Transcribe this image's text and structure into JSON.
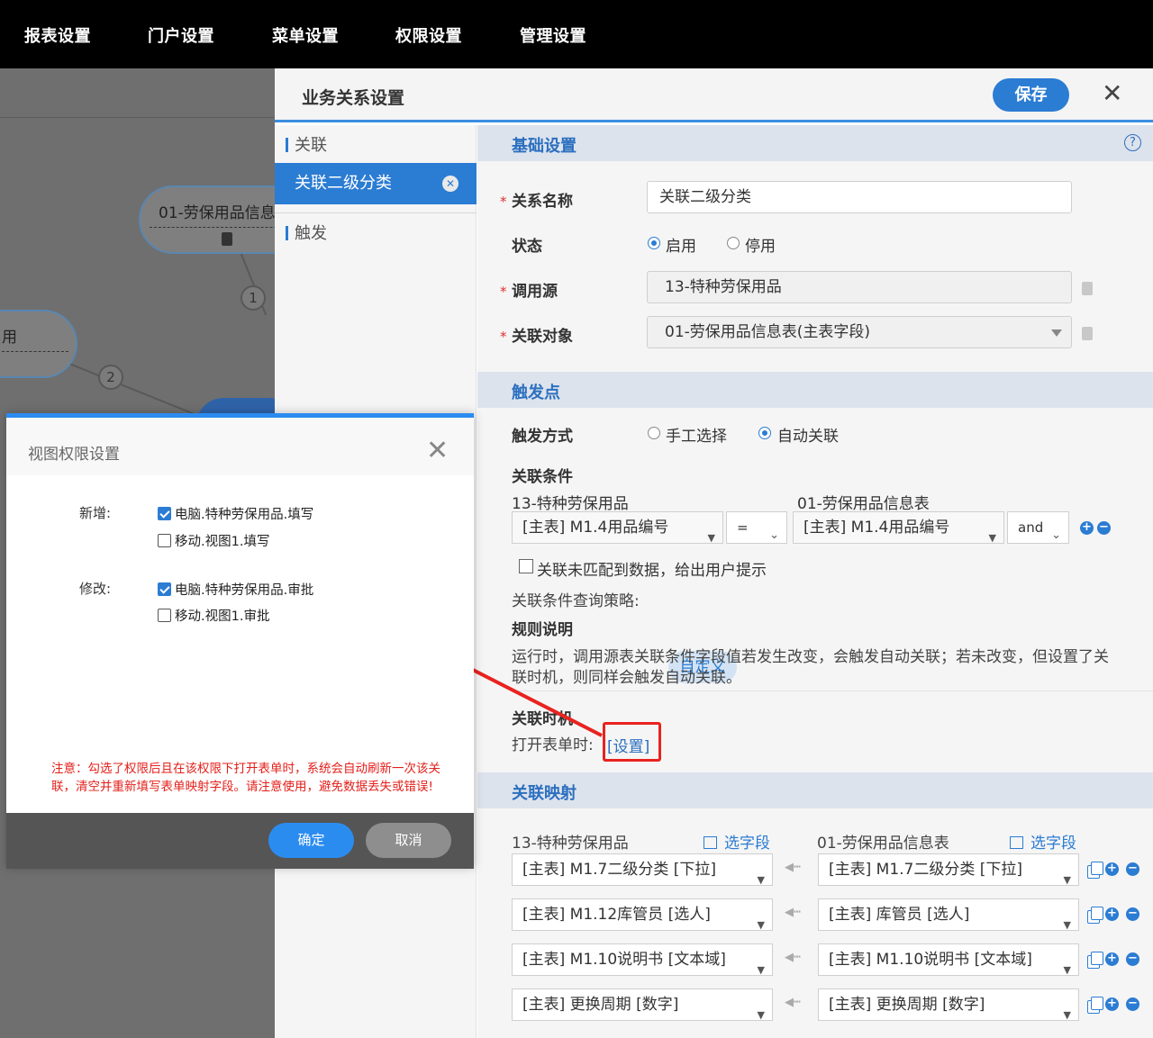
{
  "topnav": [
    "报表设置",
    "门户设置",
    "菜单设置",
    "权限设置",
    "管理设置"
  ],
  "canvas": {
    "node1": "01-劳保用品信息",
    "node2": "用",
    "badge1": "1",
    "badge2": "2"
  },
  "panel": {
    "title": "业务关系设置",
    "save": "保存",
    "close": "✕"
  },
  "sidebar": {
    "group_link": "关联",
    "active_item": "关联二级分类",
    "active_close": "✕",
    "group_trigger": "触发"
  },
  "basic": {
    "section": "基础设置",
    "help": "?",
    "name_label": "关系名称",
    "name_value": "关联二级分类",
    "status_label": "状态",
    "status_on": "启用",
    "status_off": "停用",
    "source_label": "调用源",
    "source_value": "13-特种劳保用品",
    "target_label": "关联对象",
    "target_value": "01-劳保用品信息表(主表字段)"
  },
  "trigger": {
    "section": "触发点",
    "mode_label": "触发方式",
    "mode_manual": "手工选择",
    "mode_auto": "自动关联",
    "cond_label": "关联条件",
    "cond_left_title": "13-特种劳保用品",
    "cond_right_title": "01-劳保用品信息表",
    "cond_left_field": "[主表] M1.4用品编号",
    "cond_op": "=",
    "cond_right_field": "[主表] M1.4用品编号",
    "cond_logic": "and",
    "nomatch_text": "关联未匹配到数据，给出用户提示",
    "strategy_label": "关联条件查询策略:",
    "strategy_value": "自定义",
    "rule_label": "规则说明",
    "rule_text_1": "运行时，调用源表关联条件字段值若发生改变，会触发自动关联；若未改变，但设置了关",
    "rule_text_2": "联时机，则同样会触发自动关联。",
    "timing_label": "关联时机",
    "open_form_label": "打开表单时:",
    "open_form_link": "[设置]"
  },
  "mapping": {
    "section": "关联映射",
    "left_title": "13-特种劳保用品",
    "right_title": "01-劳保用品信息表",
    "pick_left": "选字段",
    "pick_right": "选字段",
    "rows": [
      {
        "left": "[主表] M1.7二级分类 [下拉]",
        "right": "[主表] M1.7二级分类 [下拉]"
      },
      {
        "left": "[主表] M1.12库管员 [选人]",
        "right": "[主表] 库管员 [选人]"
      },
      {
        "left": "[主表] M1.10说明书 [文本域]",
        "right": "[主表] M1.10说明书 [文本域]"
      },
      {
        "left": "[主表] 更换周期 [数字]",
        "right": "[主表] 更换周期 [数字]"
      }
    ]
  },
  "dialog": {
    "title": "视图权限设置",
    "close": "✕",
    "add_label": "新增:",
    "add_opt1": "电脑.特种劳保用品.填写",
    "add_opt2": "移动.视图1.填写",
    "edit_label": "修改:",
    "edit_opt1": "电脑.特种劳保用品.审批",
    "edit_opt2": "移动.视图1.审批",
    "warning": "注意：勾选了权限后且在该权限下打开表单时，系统会自动刷新一次该关联，清空并重新填写表单映射字段。请注意使用，避免数据丢失或错误!",
    "ok": "确定",
    "cancel": "取消"
  },
  "colors": {
    "accent": "#2b7cd3",
    "annotation_red": "#e8231f",
    "section_title": "#2b6fc0"
  }
}
